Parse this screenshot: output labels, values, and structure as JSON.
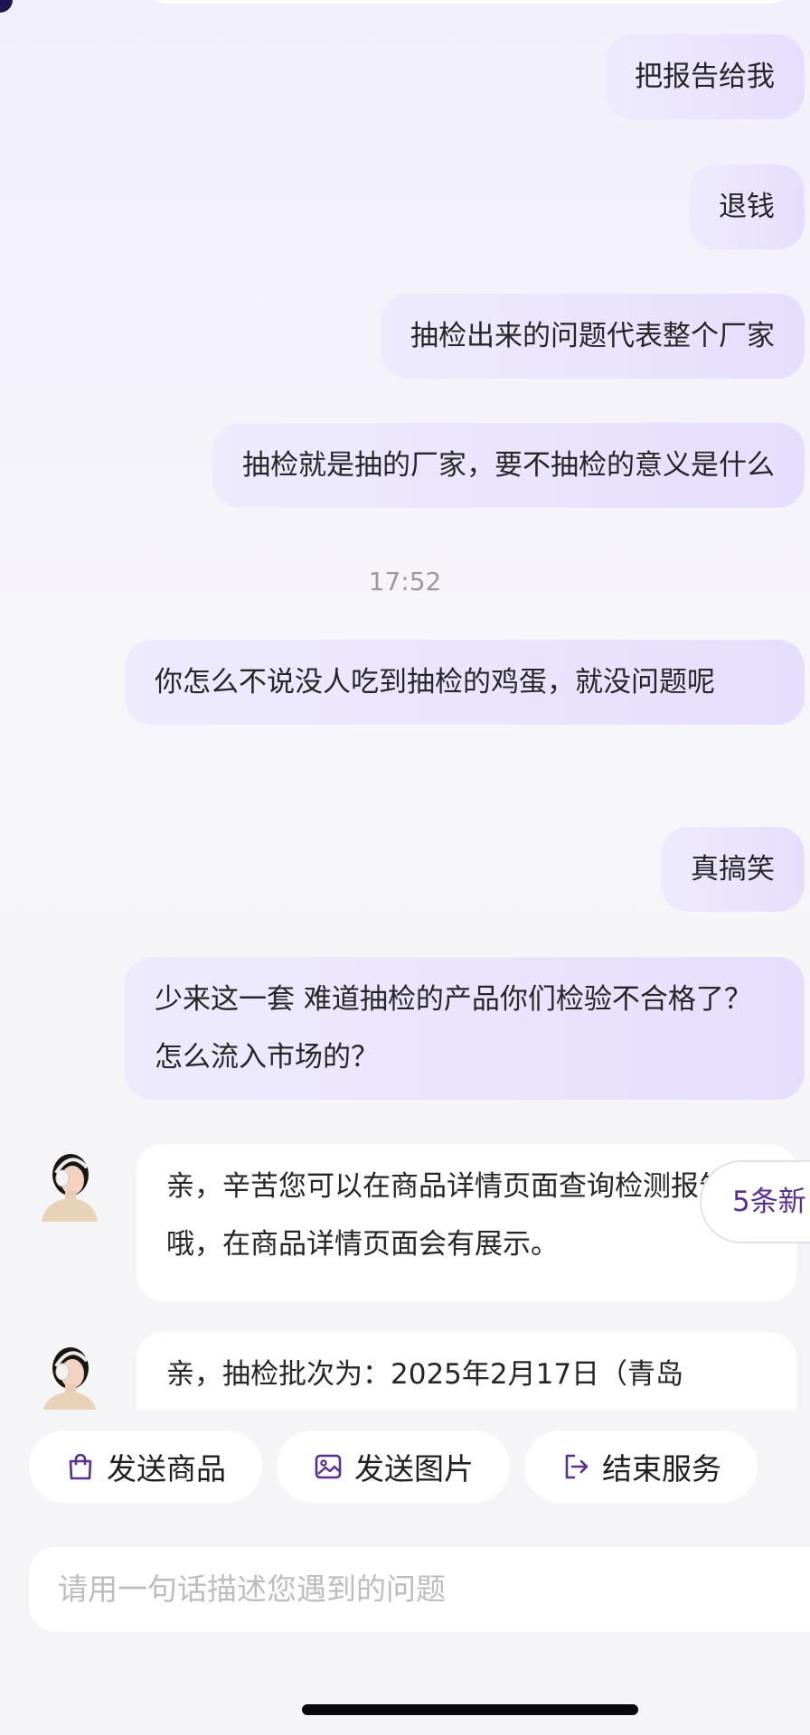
{
  "chat": {
    "outgoing": [
      {
        "text": "把报告给我"
      },
      {
        "text": "退钱"
      },
      {
        "text": "抽检出来的问题代表整个厂家"
      },
      {
        "text": "抽检就是抽的厂家，要不抽检的意义是什么"
      },
      {
        "text": "你怎么不说没人吃到抽检的鸡蛋，就没问题呢"
      },
      {
        "text": "真搞笑"
      },
      {
        "text": "少来这一套 难道抽检的产品你们检验不合格了？怎么流入市场的？"
      }
    ],
    "timestamp": "17:52",
    "incoming": [
      {
        "text": "亲，辛苦您可以在商品详情页面查询检测报告哦，在商品详情页面会有展示。"
      },
      {
        "text": "亲，抽检批次为：2025年2月17日（青岛"
      }
    ],
    "new_messages_badge": "5条新"
  },
  "quick_actions": [
    {
      "label": "发送商品",
      "icon": "shopping-bag-icon"
    },
    {
      "label": "发送图片",
      "icon": "image-icon"
    },
    {
      "label": "结束服务",
      "icon": "exit-icon"
    }
  ],
  "input": {
    "placeholder": "请用一句话描述您遇到的问题"
  },
  "colors": {
    "accent": "#5b2f90",
    "outgoing_bubble_start": "#eeebfd",
    "outgoing_bubble_end": "#e6defd",
    "incoming_bubble": "#ffffff",
    "background": "#f5f5f7"
  }
}
